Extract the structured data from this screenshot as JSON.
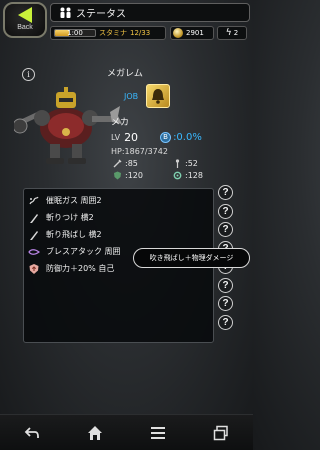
{
  "header": {
    "back_label": "Back",
    "title": "ステータス"
  },
  "status": {
    "stamina_time": "1:00",
    "stamina_label": "スタミナ",
    "stamina_value": "12/33",
    "stamina_fraction": 0.36,
    "coins": "2901",
    "bolts": "2"
  },
  "character": {
    "info_label": "i",
    "name": "メガレム",
    "job_label": "JOB",
    "type": "メカ",
    "lv_label": "LV",
    "level": "20",
    "crit_label": "B",
    "crit_rate": ":0.0%",
    "hp": "HP:1867/3742",
    "stats": [
      {
        "icon": "sword-icon",
        "value": ":85"
      },
      {
        "icon": "staff-icon",
        "value": ":52"
      },
      {
        "icon": "shield-icon",
        "value": ":120"
      },
      {
        "icon": "gear-icon",
        "value": ":128"
      }
    ]
  },
  "skills": [
    {
      "icon": "gas-icon",
      "label": "催眠ガス 周囲2"
    },
    {
      "icon": "blade-icon",
      "label": "斬りつけ 横2"
    },
    {
      "icon": "blade-icon",
      "label": "斬り飛ばし 横2"
    },
    {
      "icon": "breath-icon",
      "label": "ブレスアタック 周囲"
    },
    {
      "icon": "shield-up-icon",
      "label": "防御力＋20% 自己"
    }
  ],
  "help_buttons": [
    "?",
    "?",
    "?",
    "?",
    "?",
    "?",
    "?",
    "?"
  ],
  "tooltip": "吹き飛ばし＋物理ダメージ",
  "nav": [
    "back-arrow-icon",
    "home-icon",
    "menu-icon",
    "windows-icon"
  ],
  "colors": {
    "accent_green": "#c9f23a",
    "stamina_gold": "#f3c545",
    "job_blue": "#39b8ff"
  }
}
